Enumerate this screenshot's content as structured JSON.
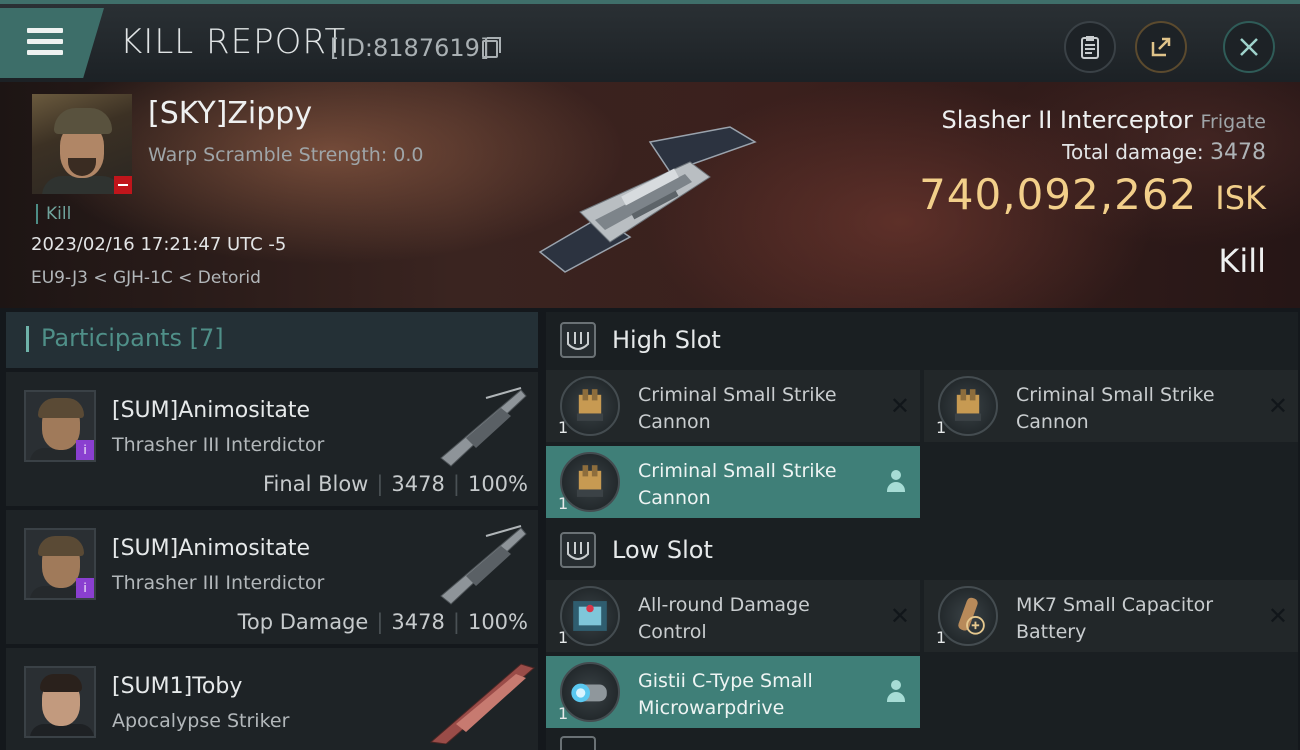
{
  "header": {
    "title": "KILL REPORT",
    "report_id": "[ID:8187619]"
  },
  "victim": {
    "name": "[SKY]Zippy",
    "warp_scramble": "Warp Scramble Strength: 0.0",
    "kill_tag": "Kill",
    "datetime": "2023/02/16 17:21:47 UTC -5",
    "location": "EU9-J3 < GJH-1C < Detorid",
    "ship_name": "Slasher II Interceptor",
    "ship_class": "Frigate",
    "total_damage_label": "Total damage:",
    "total_damage_value": "3478",
    "isk_value": "740,092,262",
    "isk_unit": "ISK",
    "result": "Kill"
  },
  "participants": {
    "header": "Participants [7]",
    "items": [
      {
        "name": "[SUM]Animositate",
        "ship": "Thrasher III Interdictor",
        "tag": "Final Blow",
        "damage": "3478",
        "percent": "100%"
      },
      {
        "name": "[SUM]Animositate",
        "ship": "Thrasher III Interdictor",
        "tag": "Top Damage",
        "damage": "3478",
        "percent": "100%"
      },
      {
        "name": "[SUM1]Toby",
        "ship": "Apocalypse Striker"
      }
    ]
  },
  "fitting": {
    "high_slot": {
      "label": "High Slot",
      "modules": [
        {
          "name": "Criminal Small Strike Cannon",
          "qty": "1"
        },
        {
          "name": "Criminal Small Strike Cannon",
          "qty": "1"
        },
        {
          "name": "Criminal Small Strike Cannon",
          "qty": "1"
        }
      ]
    },
    "low_slot": {
      "label": "Low Slot",
      "modules": [
        {
          "name": "All-round Damage Control",
          "qty": "1"
        },
        {
          "name": "MK7 Small Capacitor Battery",
          "qty": "1"
        },
        {
          "name": "Gistii C-Type Small Microwarpdrive",
          "qty": "1"
        }
      ]
    }
  },
  "colors": {
    "accent_teal": "#3f7f78",
    "isk_gold": "#f2cf8a",
    "alert_red": "#c0151b"
  }
}
